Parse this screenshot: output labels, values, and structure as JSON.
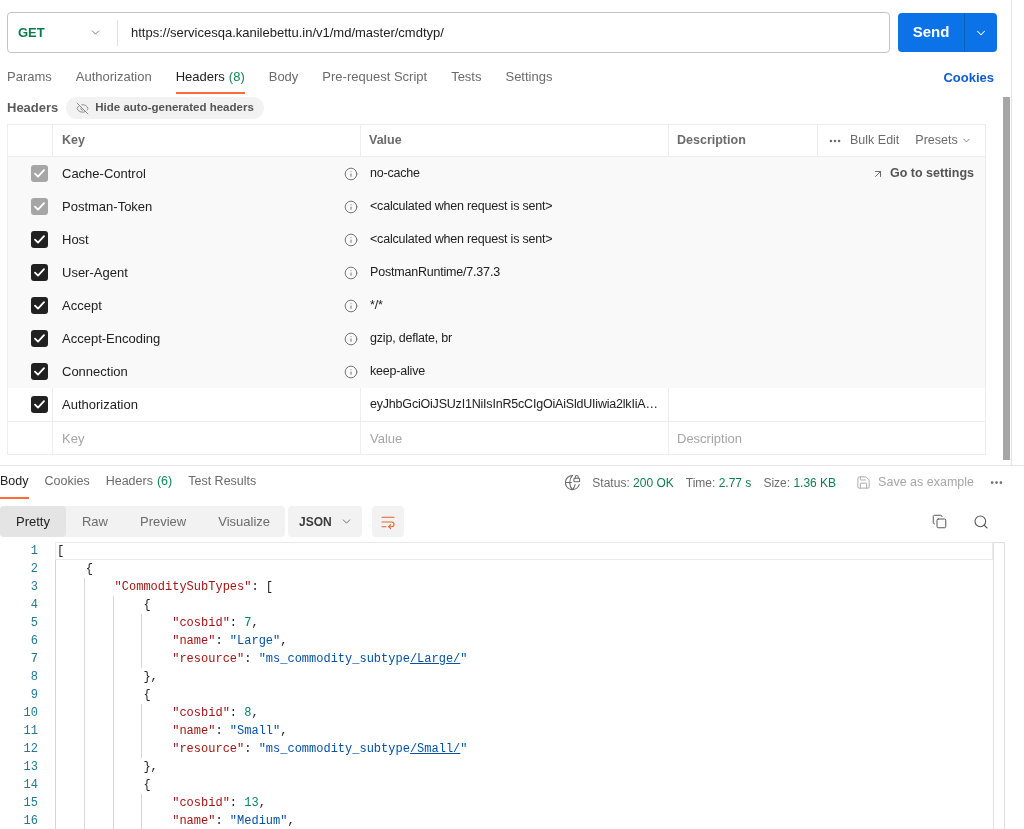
{
  "request": {
    "method": "GET",
    "url": "https://servicesqa.kanilebettu.in/v1/md/master/cmdtyp/",
    "send": "Send"
  },
  "request_tabs": [
    {
      "label": "Params",
      "selected": false
    },
    {
      "label": "Authorization",
      "selected": false
    },
    {
      "label": "Headers",
      "count": "(8)",
      "selected": true
    },
    {
      "label": "Body",
      "selected": false
    },
    {
      "label": "Pre-request Script",
      "selected": false
    },
    {
      "label": "Tests",
      "selected": false
    },
    {
      "label": "Settings",
      "selected": false
    }
  ],
  "cookies": "Cookies",
  "headers_bar": {
    "title": "Headers",
    "toggle": "Hide auto-generated headers"
  },
  "headers_table": {
    "columns": [
      "Key",
      "Value",
      "Description"
    ],
    "bulk_edit": "Bulk Edit",
    "presets": "Presets",
    "go_to_settings": "Go to settings",
    "rows": [
      {
        "key": "Cache-Control",
        "value": "no-cache",
        "checked": true,
        "disabled": true,
        "auto_generated": true
      },
      {
        "key": "Postman-Token",
        "value": "<calculated when request is sent>",
        "checked": true,
        "disabled": true,
        "auto_generated": true
      },
      {
        "key": "Host",
        "value": "<calculated when request is sent>",
        "checked": true,
        "disabled": false,
        "auto_generated": true
      },
      {
        "key": "User-Agent",
        "value": "PostmanRuntime/7.37.3",
        "checked": true,
        "disabled": false,
        "auto_generated": true
      },
      {
        "key": "Accept",
        "value": "*/*",
        "checked": true,
        "disabled": false,
        "auto_generated": true
      },
      {
        "key": "Accept-Encoding",
        "value": "gzip, deflate, br",
        "checked": true,
        "disabled": false,
        "auto_generated": true
      },
      {
        "key": "Connection",
        "value": "keep-alive",
        "checked": true,
        "disabled": false,
        "auto_generated": true
      },
      {
        "key": "Authorization",
        "value": "eyJhbGciOiJSUzI1NiIsInR5cCIgOiAiSldUIiwia2lkIiA…",
        "checked": true,
        "disabled": false,
        "auto_generated": false
      }
    ],
    "new_row": {
      "key_placeholder": "Key",
      "value_placeholder": "Value",
      "description_placeholder": "Description"
    }
  },
  "response": {
    "tabs": [
      {
        "label": "Body",
        "selected": true
      },
      {
        "label": "Cookies",
        "selected": false
      },
      {
        "label": "Headers",
        "count": "(6)",
        "selected": false
      },
      {
        "label": "Test Results",
        "selected": false
      }
    ],
    "status": {
      "label": "Status:",
      "value": "200 OK"
    },
    "time": {
      "label": "Time:",
      "value": "2.77 s"
    },
    "size": {
      "label": "Size:",
      "value": "1.36 KB"
    },
    "save_example": {
      "label": "Save as example",
      "disabled": true
    },
    "view_modes": [
      {
        "label": "Pretty",
        "selected": true
      },
      {
        "label": "Raw",
        "selected": false
      },
      {
        "label": "Preview",
        "selected": false
      },
      {
        "label": "Visualize",
        "selected": false
      }
    ],
    "format": "JSON",
    "wrap_lines": true,
    "code_lines": [
      {
        "number": "1",
        "current": true,
        "tokens": [
          {
            "kind": "punct",
            "text": "["
          }
        ]
      },
      {
        "number": "2",
        "current": false,
        "tokens": [
          {
            "kind": "punct",
            "text": "    {"
          }
        ]
      },
      {
        "number": "3",
        "current": false,
        "tokens": [
          {
            "kind": "key",
            "text": "        \"CommoditySubTypes\""
          },
          {
            "kind": "punct",
            "text": ": ["
          }
        ]
      },
      {
        "number": "4",
        "current": false,
        "tokens": [
          {
            "kind": "punct",
            "text": "            {"
          }
        ]
      },
      {
        "number": "5",
        "current": false,
        "tokens": [
          {
            "kind": "key",
            "text": "                \"cosbid\""
          },
          {
            "kind": "punct",
            "text": ": "
          },
          {
            "kind": "number",
            "text": "7"
          },
          {
            "kind": "punct",
            "text": ","
          }
        ]
      },
      {
        "number": "6",
        "current": false,
        "tokens": [
          {
            "kind": "key",
            "text": "                \"name\""
          },
          {
            "kind": "punct",
            "text": ": "
          },
          {
            "kind": "string",
            "text": "\"Large\""
          },
          {
            "kind": "punct",
            "text": ","
          }
        ]
      },
      {
        "number": "7",
        "current": false,
        "tokens": [
          {
            "kind": "key",
            "text": "                \"resource\""
          },
          {
            "kind": "punct",
            "text": ": "
          },
          {
            "kind": "string",
            "text": "\"ms_commodity_subtype"
          },
          {
            "kind": "link",
            "text": "/Large/"
          },
          {
            "kind": "string",
            "text": "\""
          }
        ]
      },
      {
        "number": "8",
        "current": false,
        "tokens": [
          {
            "kind": "punct",
            "text": "            },"
          }
        ]
      },
      {
        "number": "9",
        "current": false,
        "tokens": [
          {
            "kind": "punct",
            "text": "            {"
          }
        ]
      },
      {
        "number": "10",
        "current": false,
        "tokens": [
          {
            "kind": "key",
            "text": "                \"cosbid\""
          },
          {
            "kind": "punct",
            "text": ": "
          },
          {
            "kind": "number",
            "text": "8"
          },
          {
            "kind": "punct",
            "text": ","
          }
        ]
      },
      {
        "number": "11",
        "current": false,
        "tokens": [
          {
            "kind": "key",
            "text": "                \"name\""
          },
          {
            "kind": "punct",
            "text": ": "
          },
          {
            "kind": "string",
            "text": "\"Small\""
          },
          {
            "kind": "punct",
            "text": ","
          }
        ]
      },
      {
        "number": "12",
        "current": false,
        "tokens": [
          {
            "kind": "key",
            "text": "                \"resource\""
          },
          {
            "kind": "punct",
            "text": ": "
          },
          {
            "kind": "string",
            "text": "\"ms_commodity_subtype"
          },
          {
            "kind": "link",
            "text": "/Small/"
          },
          {
            "kind": "string",
            "text": "\""
          }
        ]
      },
      {
        "number": "13",
        "current": false,
        "tokens": [
          {
            "kind": "punct",
            "text": "            },"
          }
        ]
      },
      {
        "number": "14",
        "current": false,
        "tokens": [
          {
            "kind": "punct",
            "text": "            {"
          }
        ]
      },
      {
        "number": "15",
        "current": false,
        "tokens": [
          {
            "kind": "key",
            "text": "                \"cosbid\""
          },
          {
            "kind": "punct",
            "text": ": "
          },
          {
            "kind": "number",
            "text": "13"
          },
          {
            "kind": "punct",
            "text": ","
          }
        ]
      },
      {
        "number": "16",
        "current": false,
        "tokens": [
          {
            "kind": "key",
            "text": "                \"name\""
          },
          {
            "kind": "punct",
            "text": ": "
          },
          {
            "kind": "string",
            "text": "\"Medium\""
          },
          {
            "kind": "punct",
            "text": ","
          }
        ]
      }
    ]
  }
}
